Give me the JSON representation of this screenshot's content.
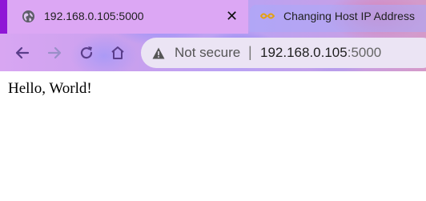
{
  "tabs": [
    {
      "title": "192.168.0.105:5000",
      "active": true,
      "icon": "globe-icon"
    },
    {
      "title": "Changing Host IP Address",
      "active": false,
      "icon": "colab-icon"
    }
  ],
  "toolbar": {
    "back_icon": "back-arrow-icon",
    "forward_icon": "forward-arrow-icon",
    "reload_icon": "reload-icon",
    "home_icon": "home-icon"
  },
  "address_bar": {
    "security_text": "Not secure",
    "separator": "|",
    "url_host": "192.168.0.105",
    "url_port": ":5000"
  },
  "page": {
    "body_text": "Hello, World!"
  },
  "colors": {
    "active_tab": "#dca7f4",
    "omnibox": "#ebe4f4",
    "accent": "#8f17d6"
  }
}
